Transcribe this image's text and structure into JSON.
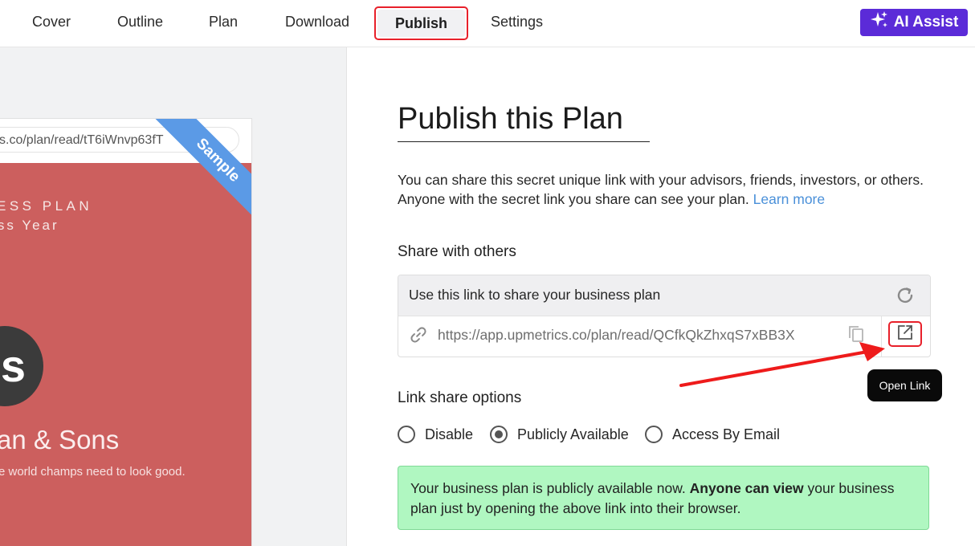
{
  "nav": {
    "tabs": [
      {
        "label": "Cover"
      },
      {
        "label": "Outline"
      },
      {
        "label": "Plan"
      },
      {
        "label": "Download"
      },
      {
        "label": "Publish",
        "active": true
      },
      {
        "label": "Settings"
      }
    ],
    "ai_assist_label": "AI Assist",
    "ai_assist_icon": "sparkles-icon",
    "accent_color": "#5b2bd8"
  },
  "preview": {
    "url": "s.co/plan/read/tT6iWnvp63fT",
    "ribbon_label": "Sample",
    "cover_line1": "INESS PLAN",
    "cover_line2": "ness Year",
    "logo_text": "s",
    "company_name": "an & Sons",
    "tagline": "e world champs need to look good.",
    "cover_color": "#cc5f5e"
  },
  "main": {
    "title": "Publish this Plan",
    "description": "You can share this secret unique link with your advisors, friends, investors, or others. Anyone with the secret link you share can see your plan.",
    "learn_more": "Learn more",
    "share_heading": "Share with others",
    "share_box": {
      "header": "Use this link to share your business plan",
      "link": "https://app.upmetrics.co/plan/read/QCfkQkZhxqS7xBB3X",
      "tooltip": "Open Link"
    },
    "options_heading": "Link share options",
    "options": [
      {
        "label": "Disable",
        "checked": false
      },
      {
        "label": "Publicly Available",
        "checked": true
      },
      {
        "label": "Access By Email",
        "checked": false
      }
    ],
    "notice": {
      "part1": "Your business plan is publicly available now. ",
      "bold": "Anyone can view",
      "part2": " your business plan just by opening the above link into their browser."
    }
  }
}
